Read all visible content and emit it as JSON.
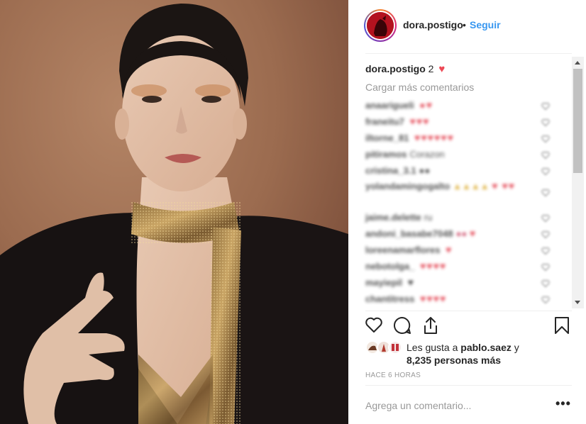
{
  "post": {
    "author": "dora.postigo",
    "follow_label": "Seguir",
    "dot": "•",
    "caption_user": "dora.postigo",
    "caption_text": "2",
    "caption_heart": "♥",
    "load_more": "Cargar más comentarios",
    "comments": [
      {
        "user": "anaarigueli",
        "text": "",
        "hearts": "●♥"
      },
      {
        "user": "franeitu7",
        "text": "",
        "hearts": "♥♥♥"
      },
      {
        "user": "iltorne_81",
        "text": "",
        "hearts": "♥♥♥♥♥♥"
      },
      {
        "user": "pitiramos",
        "text": "Corazon",
        "hearts": ""
      },
      {
        "user": "cristina_3.1",
        "text": "●●",
        "hearts": ""
      },
      {
        "user": "yolandamingogalto",
        "text": "▲▲▲▲",
        "hearts": "♥ ♥♥"
      },
      {
        "user": "jaime.delette",
        "text": "ru",
        "hearts": ""
      },
      {
        "user": "andoni_basabe7048",
        "text": "●●",
        "hearts": "♥"
      },
      {
        "user": "loreenamarflores",
        "text": "",
        "hearts": "♥"
      },
      {
        "user": "nebotolga_",
        "text": "",
        "hearts": "♥♥♥♥"
      },
      {
        "user": "mayiepil",
        "text": "",
        "hearts": "♥"
      },
      {
        "user": "chantitress",
        "text": "",
        "hearts": "♥♥♥♥"
      }
    ],
    "likes_prefix": "Les gusta a",
    "likes_user": "pablo.saez",
    "likes_and": "y",
    "likes_count": "8,235 personas más",
    "timestamp": "HACE 6 HORAS",
    "comment_placeholder": "Agrega un comentario...",
    "more_options": "•••"
  },
  "icons": {
    "like": "heart-outline-icon",
    "comment": "speech-bubble-icon",
    "share": "share-arrow-icon",
    "save": "bookmark-icon"
  },
  "colors": {
    "link": "#3897f0",
    "heart": "#ed4956",
    "muted": "#999999",
    "text": "#262626"
  }
}
